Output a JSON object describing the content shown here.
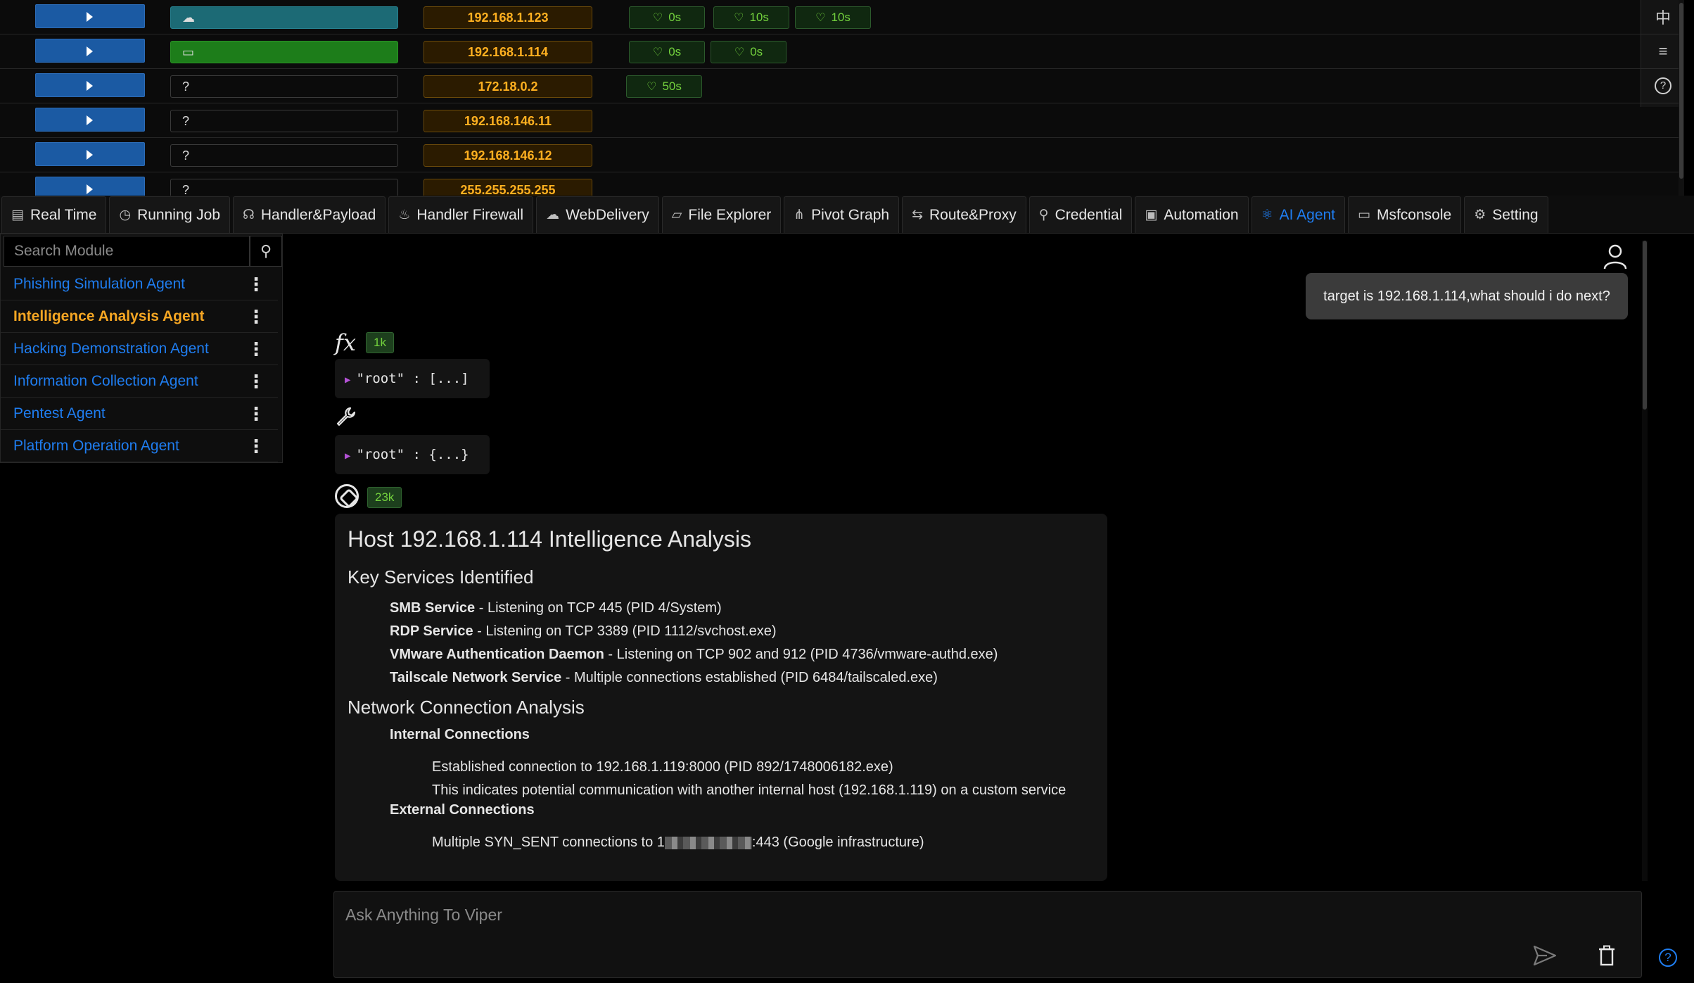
{
  "hosts": [
    {
      "os": "cloud",
      "os_glyph": "☁",
      "ip": "192.168.1.123",
      "heartbeats": [
        "0s",
        "10s",
        "10s"
      ]
    },
    {
      "os": "laptop",
      "os_glyph": "▭",
      "ip": "192.168.1.114",
      "heartbeats": [
        "0s",
        "0s"
      ]
    },
    {
      "os": "unknown",
      "os_glyph": "?",
      "ip": "172.18.0.2",
      "heartbeats": [
        "50s"
      ]
    },
    {
      "os": "unknown",
      "os_glyph": "?",
      "ip": "192.168.146.11",
      "heartbeats": []
    },
    {
      "os": "unknown",
      "os_glyph": "?",
      "ip": "192.168.146.12",
      "heartbeats": []
    },
    {
      "os": "unknown",
      "os_glyph": "?",
      "ip": "255.255.255.255",
      "heartbeats": []
    }
  ],
  "right_tools": {
    "lang": "中",
    "list": "≡",
    "help": "?"
  },
  "tabs": [
    {
      "label": "Real Time",
      "icon": "dashboard-icon",
      "glyph": "▤"
    },
    {
      "label": "Running Job",
      "icon": "history-icon",
      "glyph": "◷"
    },
    {
      "label": "Handler&Payload",
      "icon": "headset-icon",
      "glyph": "☊"
    },
    {
      "label": "Handler Firewall",
      "icon": "fire-icon",
      "glyph": "♨"
    },
    {
      "label": "WebDelivery",
      "icon": "cloud-upload-icon",
      "glyph": "☁"
    },
    {
      "label": "File Explorer",
      "icon": "folder-icon",
      "glyph": "▱"
    },
    {
      "label": "Pivot Graph",
      "icon": "graph-icon",
      "glyph": "⋔"
    },
    {
      "label": "Route&Proxy",
      "icon": "route-icon",
      "glyph": "⇆"
    },
    {
      "label": "Credential",
      "icon": "key-icon",
      "glyph": "⚲"
    },
    {
      "label": "Automation",
      "icon": "robot-icon",
      "glyph": "▣"
    },
    {
      "label": "AI Agent",
      "icon": "atom-icon",
      "glyph": "⚛",
      "active": true
    },
    {
      "label": "Msfconsole",
      "icon": "console-icon",
      "glyph": "▭"
    },
    {
      "label": "Setting",
      "icon": "gear-icon",
      "glyph": "⚙"
    }
  ],
  "search": {
    "placeholder": "Search Module"
  },
  "agents": [
    {
      "label": "Phishing Simulation Agent",
      "active": false
    },
    {
      "label": "Intelligence Analysis Agent",
      "active": true
    },
    {
      "label": "Hacking Demonstration Agent",
      "active": false
    },
    {
      "label": "Information Collection Agent",
      "active": false
    },
    {
      "label": "Pentest Agent",
      "active": false
    },
    {
      "label": "Platform Operation Agent",
      "active": false
    }
  ],
  "chat": {
    "user_message": "target is 192.168.1.114,what should i do next?",
    "fx_label": "fx",
    "fx_tokens": "1k",
    "tool_call_json": "\"root\" : [...]",
    "tool_result_json": "\"root\" : {...}",
    "answer_tokens": "23k",
    "answer": {
      "title": "Host 192.168.1.114 Intelligence Analysis",
      "section1": "Key Services Identified",
      "services": [
        {
          "name": "SMB Service",
          "detail": " - Listening on TCP 445 (PID 4/System)"
        },
        {
          "name": "RDP Service",
          "detail": " - Listening on TCP 3389 (PID 1112/svchost.exe)"
        },
        {
          "name": "VMware Authentication Daemon",
          "detail": " - Listening on TCP 902 and 912 (PID 4736/vmware-authd.exe)"
        },
        {
          "name": "Tailscale Network Service",
          "detail": " - Multiple connections established (PID 6484/tailscaled.exe)"
        }
      ],
      "section2": "Network Connection Analysis",
      "internal_title": "Internal Connections",
      "internal": [
        "Established connection to 192.168.1.119:8000 (PID 892/1748006182.exe)",
        "This indicates potential communication with another internal host (192.168.1.119) on a custom service"
      ],
      "external_title": "External Connections",
      "external_prefix": "Multiple SYN_SENT connections to 1",
      "external_suffix": ":443 (Google infrastructure)"
    }
  },
  "composer": {
    "placeholder": "Ask Anything To Viper"
  },
  "colors": {
    "accent": "#1f7df0",
    "ip_text": "#ffb020",
    "active_agent": "#f5a623",
    "heartbeat": "#73d13d"
  }
}
